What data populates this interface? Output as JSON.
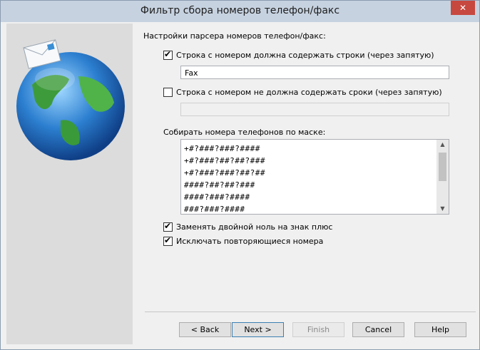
{
  "window": {
    "title": "Фильтр сбора номеров телефон/факс",
    "close_glyph": "✕"
  },
  "sidebar": {
    "icon": "globe-envelope-icon"
  },
  "main": {
    "section_label": "Настройки парсера номеров телефон/факс:",
    "include": {
      "label": "Строка с номером должна содержать строки (через запятую)",
      "checked": true,
      "value": "Fax"
    },
    "exclude": {
      "label": "Строка с номером не должна содержать сроки (через запятую)",
      "checked": false,
      "value": ""
    },
    "mask_label": "Собирать номера телефонов по маске:",
    "mask_lines": [
      "+#?###?###?####",
      "+#?###?##?##?###",
      "+#?###?###?##?##",
      "####?##?##?###",
      "####?###?####",
      "###?###?####"
    ],
    "replace_zeros": {
      "label": "Заменять двойной ноль на знак плюс",
      "checked": true
    },
    "exclude_duplicates": {
      "label": "Исключать повторяющиеся номера",
      "checked": true
    }
  },
  "buttons": {
    "back": "< Back",
    "next": "Next >",
    "finish": "Finish",
    "cancel": "Cancel",
    "help": "Help"
  }
}
